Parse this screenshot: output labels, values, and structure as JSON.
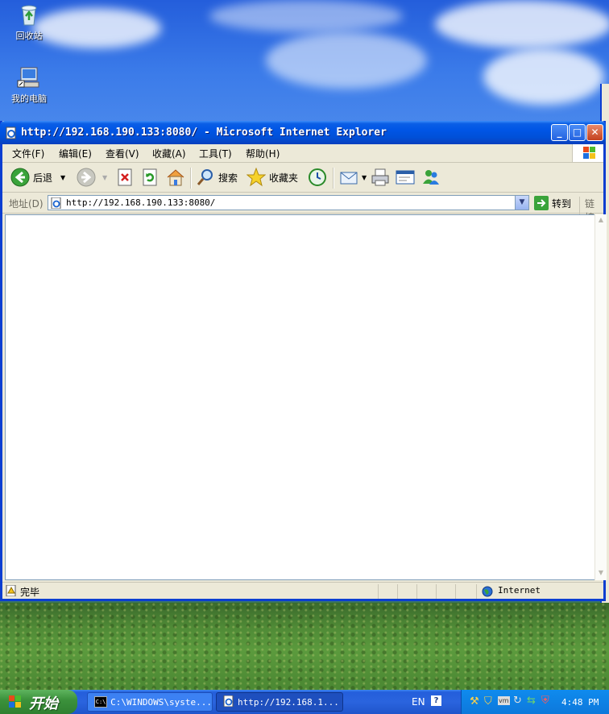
{
  "desktop": {
    "icons": [
      {
        "label": "回收站",
        "icon": "recycle-bin-icon"
      },
      {
        "label": "我的电脑",
        "icon": "my-computer-icon"
      }
    ]
  },
  "window": {
    "title": "http://192.168.190.133:8080/ - Microsoft Internet Explorer",
    "menu": [
      "文件(F)",
      "编辑(E)",
      "查看(V)",
      "收藏(A)",
      "工具(T)",
      "帮助(H)"
    ],
    "toolbar": {
      "back_label": "后退",
      "search_label": "搜索",
      "favorites_label": "收藏夹"
    },
    "address": {
      "label": "地址(D)",
      "url": "http://192.168.190.133:8080/",
      "go_label": "转到",
      "links_label": "链接"
    },
    "status": {
      "text": "完毕",
      "zone": "Internet"
    }
  },
  "taskbar": {
    "start_label": "开始",
    "tasks": [
      {
        "label": "C:\\WINDOWS\\syste...",
        "icon": "cmd-icon"
      },
      {
        "label": "http://192.168.1...",
        "icon": "ie-icon"
      }
    ],
    "lang": "EN",
    "clock": "4:48 PM"
  },
  "colors": {
    "titlebar": "#0055e5",
    "taskbar": "#245edb",
    "start": "#3c923c"
  }
}
